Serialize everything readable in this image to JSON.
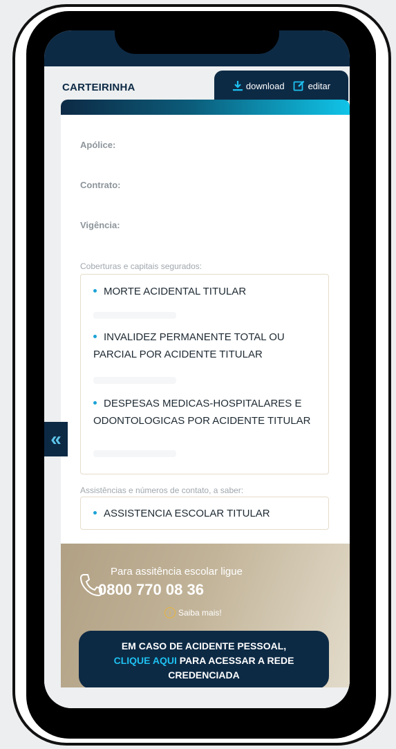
{
  "header": {
    "title": "CARTEIRINHA",
    "download_label": "download",
    "edit_label": "editar"
  },
  "fields": {
    "apolice": "Apólice:",
    "contrato": "Contrato:",
    "vigencia": "Vigência:"
  },
  "coverage": {
    "label": "Coberturas e capitais segurados:",
    "items": [
      "MORTE ACIDENTAL TITULAR",
      "INVALIDEZ PERMANENTE TOTAL OU PARCIAL POR ACIDENTE TITULAR",
      "DESPESAS MEDICAS-HOSPITALARES E ODONTOLOGICAS POR ACIDENTE TITULAR"
    ]
  },
  "assistance": {
    "label": "Assistências e números de contato, a saber:",
    "items": [
      "ASSISTENCIA ESCOLAR TITULAR"
    ]
  },
  "contact": {
    "text": "Para assitência escolar ligue",
    "number": "0800 770 08 36",
    "more": "Saiba mais!"
  },
  "cta": {
    "line1": "EM CASO DE ACIDENTE PESSOAL,",
    "link": "CLIQUE AQUI",
    "line2": " PARA ACESSAR A REDE",
    "line3": "CREDENCIADA"
  },
  "side_tab": {
    "glyph": "«"
  },
  "colors": {
    "navy": "#0d2a45",
    "accent": "#10c4e8",
    "gold": "#c2b499"
  }
}
